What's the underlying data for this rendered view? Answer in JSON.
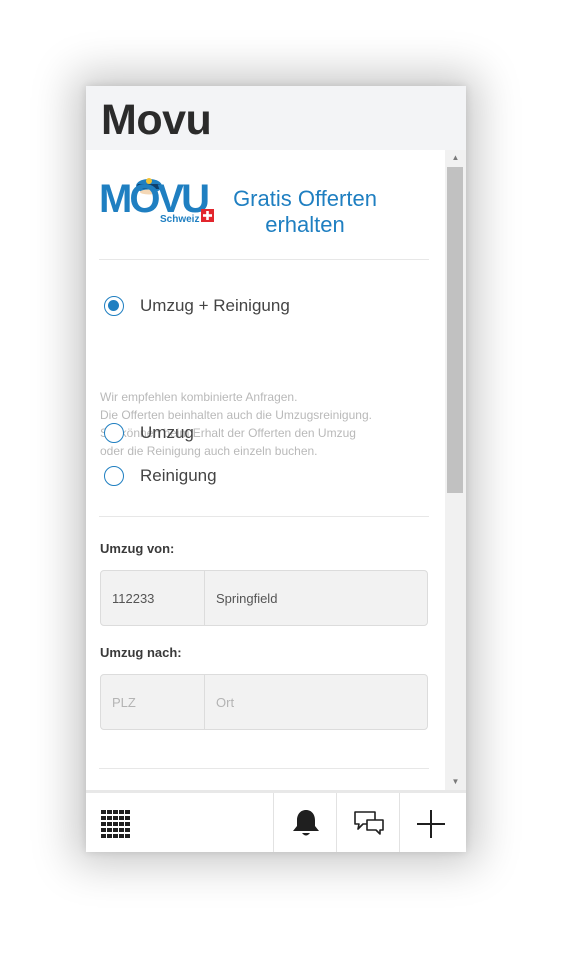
{
  "app": {
    "title": "Movu"
  },
  "logo": {
    "text": "MOVU",
    "subtext": "Schweiz"
  },
  "promo": {
    "title": "Gratis Offerten erhalten"
  },
  "service": {
    "options": [
      {
        "label": "Umzug + Reinigung",
        "checked": true
      },
      {
        "label": "Umzug",
        "checked": false
      },
      {
        "label": "Reinigung",
        "checked": false
      }
    ],
    "hint_lines": [
      "Wir empfehlen kombinierte Anfragen.",
      "Die Offerten beinhalten auch die Umzugsreinigung.",
      "Sie können beim Erhalt der Offerten den Umzug",
      "oder die Reinigung auch einzeln buchen."
    ]
  },
  "from": {
    "label": "Umzug von:",
    "zip_value": "112233",
    "zip_placeholder": "PLZ",
    "city_value": "Springfield",
    "city_placeholder": "Ort"
  },
  "to": {
    "label": "Umzug nach:",
    "zip_value": "",
    "zip_placeholder": "PLZ",
    "city_value": "",
    "city_placeholder": "Ort"
  },
  "bottom_bar": {
    "items": [
      {
        "name": "apps-grid-icon"
      },
      {
        "name": "bell-icon"
      },
      {
        "name": "chat-icon"
      },
      {
        "name": "plus-icon"
      }
    ]
  },
  "colors": {
    "accent": "#1f7fc1",
    "logo_red": "#e2262d",
    "header_bg": "#f3f4f6",
    "input_bg": "#f2f2f2",
    "hint_text": "#b9b9b9"
  }
}
